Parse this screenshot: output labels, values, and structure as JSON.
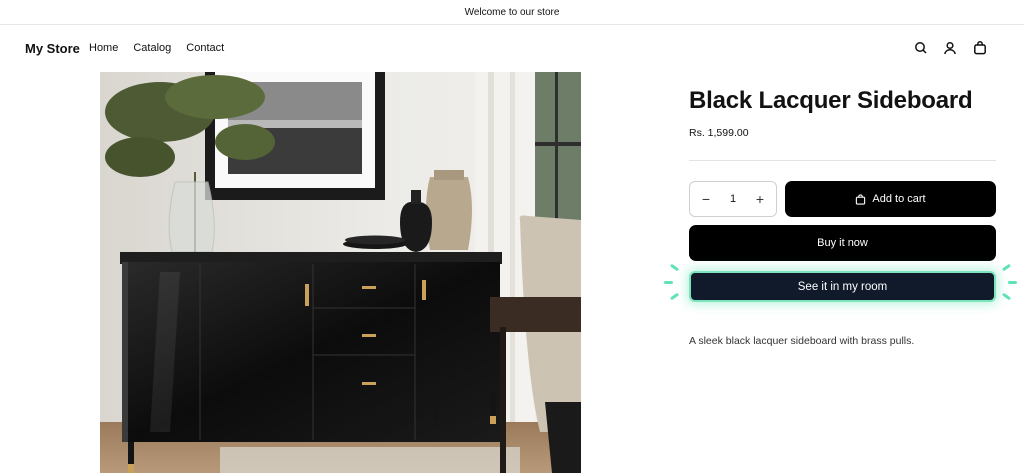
{
  "announcement": {
    "text": "Welcome to our store"
  },
  "header": {
    "logo": "My Store",
    "nav": [
      "Home",
      "Catalog",
      "Contact"
    ],
    "icons": [
      "search-icon",
      "account-icon",
      "cart-icon"
    ]
  },
  "product": {
    "title": "Black Lacquer Sideboard",
    "price": "Rs. 1,599.00",
    "quantity": "1",
    "add_to_cart": "Add to cart",
    "buy_now": "Buy it now",
    "see_in_room": "See it in my room",
    "description": "A sleek black lacquer sideboard with brass pulls.",
    "image_alt": "Black lacquer sideboard in a living room"
  },
  "colors": {
    "primary_button": "#000000",
    "ar_button": "#111a2a",
    "ar_glow": "#7de3bd"
  }
}
